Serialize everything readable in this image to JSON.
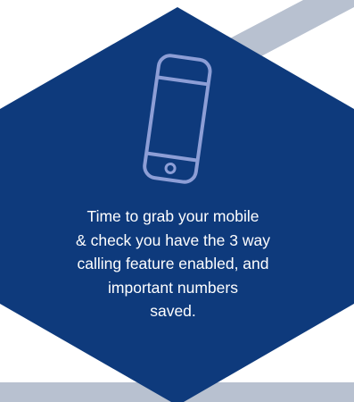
{
  "colors": {
    "hexagon": "#0e3a7c",
    "stripe": "#b8c1d0",
    "icon": "#8d9ed6",
    "text": "#ffffff",
    "background": "#ffffff"
  },
  "icon": "mobile-phone-icon",
  "message": {
    "lines": [
      "Time to grab your mobile",
      "& check you have the 3 way",
      "calling feature enabled, and",
      "important numbers",
      "saved."
    ]
  }
}
